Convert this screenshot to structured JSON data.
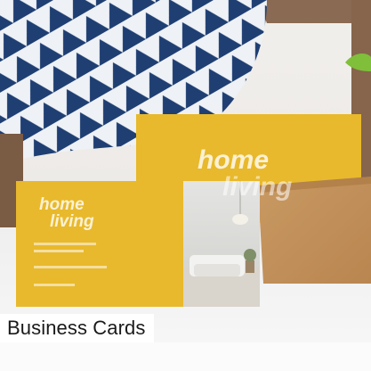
{
  "tile": {
    "caption": "Business Cards"
  },
  "card": {
    "brand_line1": "home",
    "brand_line2": "living"
  },
  "colors": {
    "card_yellow": "#e8b92c",
    "kraft_sleeve": "#c4915a",
    "caption_bg": "#ffffff",
    "caption_text": "#1a1a1a",
    "cushion_navy": "#1f3f73"
  }
}
